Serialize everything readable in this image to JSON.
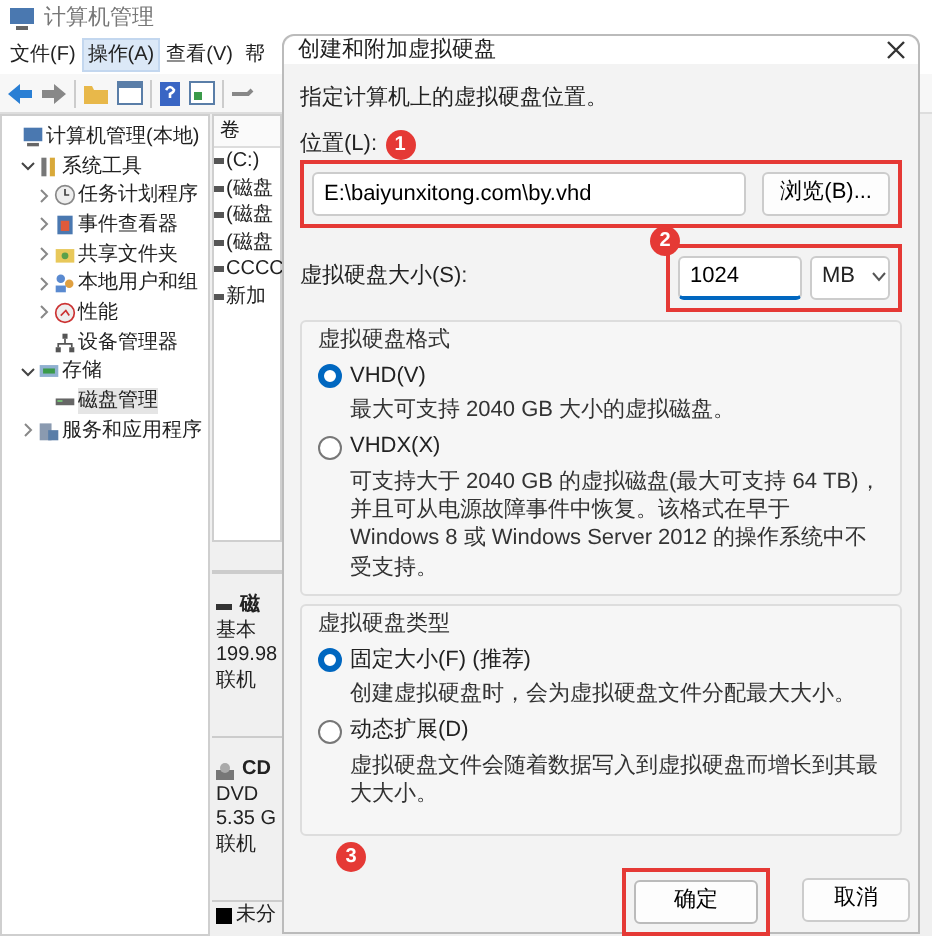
{
  "main_window": {
    "title": "计算机管理",
    "menu": [
      {
        "label": "文件(F)",
        "selected": false
      },
      {
        "label": "操作(A)",
        "selected": true
      },
      {
        "label": "查看(V)",
        "selected": false
      },
      {
        "label": "帮",
        "selected": false
      }
    ],
    "tree": [
      {
        "label": "计算机管理(本地)",
        "children": [
          {
            "label": "系统工具",
            "expanded": true,
            "children": [
              {
                "label": "任务计划程序",
                "expanded": false
              },
              {
                "label": "事件查看器",
                "expanded": false
              },
              {
                "label": "共享文件夹",
                "expanded": false
              },
              {
                "label": "本地用户和组",
                "expanded": false
              },
              {
                "label": "性能",
                "expanded": false
              },
              {
                "label": "设备管理器"
              }
            ]
          },
          {
            "label": "存储",
            "expanded": true,
            "children": [
              {
                "label": "磁盘管理",
                "selected": true
              }
            ]
          },
          {
            "label": "服务和应用程序",
            "expanded": false
          }
        ]
      }
    ],
    "volume_list": {
      "column_1": "卷",
      "rows": [
        "(C:)",
        "(磁盘",
        "(磁盘",
        "(磁盘",
        "CCCC",
        "新加"
      ]
    },
    "disks": [
      {
        "kind": "disk",
        "lines": [
          "磁",
          "基本",
          "199.98",
          "联机"
        ]
      },
      {
        "kind": "cdrom",
        "lines": [
          "CD",
          "DVD",
          "5.35 G",
          "联机"
        ]
      }
    ],
    "legend": "未分"
  },
  "dialog": {
    "title": "创建和附加虚拟硬盘",
    "intro": "指定计算机上的虚拟硬盘位置。",
    "location": {
      "label": "位置(L):",
      "value": "E:\\baiyunxitong.com\\by.vhd",
      "browse_button": "浏览(B)...",
      "annotation": "1"
    },
    "size": {
      "label": "虚拟硬盘大小(S):",
      "value": "1024",
      "unit": "MB",
      "annotation": "2"
    },
    "format": {
      "legend": "虚拟硬盘格式",
      "options": [
        {
          "label": "VHD(V)",
          "selected": true,
          "description": "最大可支持 2040 GB 大小的虚拟磁盘。"
        },
        {
          "label": "VHDX(X)",
          "selected": false,
          "description": "可支持大于 2040 GB 的虚拟磁盘(最大可支持 64 TB)，并且可从电源故障事件中恢复。该格式在早于 Windows 8 或 Windows Server 2012 的操作系统中不受支持。"
        }
      ]
    },
    "type": {
      "legend": "虚拟硬盘类型",
      "options": [
        {
          "label": "固定大小(F) (推荐)",
          "selected": true,
          "description": "创建虚拟硬盘时，会为虚拟硬盘文件分配最大大小。"
        },
        {
          "label": "动态扩展(D)",
          "selected": false,
          "description": "虚拟硬盘文件会随着数据写入到虚拟硬盘而增长到其最大大小。"
        }
      ]
    },
    "buttons": [
      {
        "label": "确定",
        "kind": "primary",
        "annotation": "3"
      },
      {
        "label": "取消",
        "kind": "secondary"
      }
    ]
  }
}
